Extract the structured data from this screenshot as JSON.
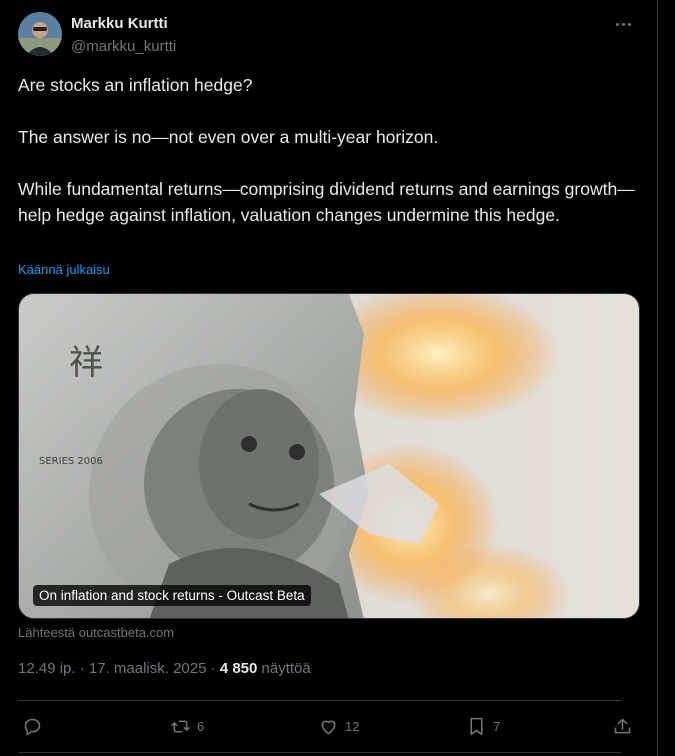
{
  "author": {
    "name": "Markku Kurtti",
    "handle": "@markku_kurtti"
  },
  "post": {
    "paragraphs": [
      "Are stocks an inflation hedge?",
      "The answer is no—not even over a multi-year horizon.",
      "While fundamental returns—comprising dividend returns and earnings growth—help hedge against inflation, valuation changes undermine this hedge."
    ],
    "translate_label": "Käännä julkaisu",
    "card_caption": "On inflation and stock returns - Outcast Beta",
    "card_source": "Lähteestä outcastbeta.com",
    "time": "12.49 ip.",
    "date": "17. maalisk. 2025",
    "views_count": "4 850",
    "views_label": "näyttöä"
  },
  "actions": {
    "replies": "",
    "reposts": "6",
    "likes": "12",
    "bookmarks": "7"
  },
  "colors": {
    "background": "#000000",
    "text": "#e7e9ea",
    "muted": "#71767b",
    "link": "#1d9bf0",
    "border": "#2f3336"
  },
  "icons": [
    "more-icon",
    "reply-icon",
    "repost-icon",
    "like-icon",
    "bookmark-icon",
    "share-icon"
  ]
}
